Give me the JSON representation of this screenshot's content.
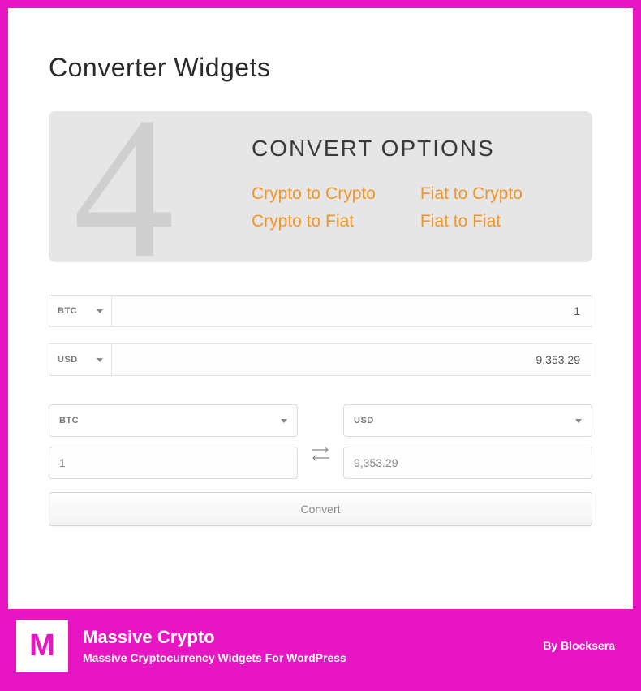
{
  "page": {
    "title": "Converter Widgets"
  },
  "hero": {
    "number": "4",
    "title": "CONVERT OPTIONS",
    "options": {
      "c2c": "Crypto to Crypto",
      "c2f": "Crypto to Fiat",
      "f2c": "Fiat to Crypto",
      "f2f": "Fiat to Fiat"
    }
  },
  "converter1": {
    "from_currency": "BTC",
    "from_value": "1",
    "to_currency": "USD",
    "to_value": "9,353.29"
  },
  "converter2": {
    "from_currency": "BTC",
    "from_value": "1",
    "to_currency": "USD",
    "to_value": "9,353.29",
    "button_label": "Convert"
  },
  "footer": {
    "logo_letter": "M",
    "title": "Massive Crypto",
    "subtitle": "Massive Cryptocurrency Widgets For WordPress",
    "author": "By Blocksera"
  }
}
